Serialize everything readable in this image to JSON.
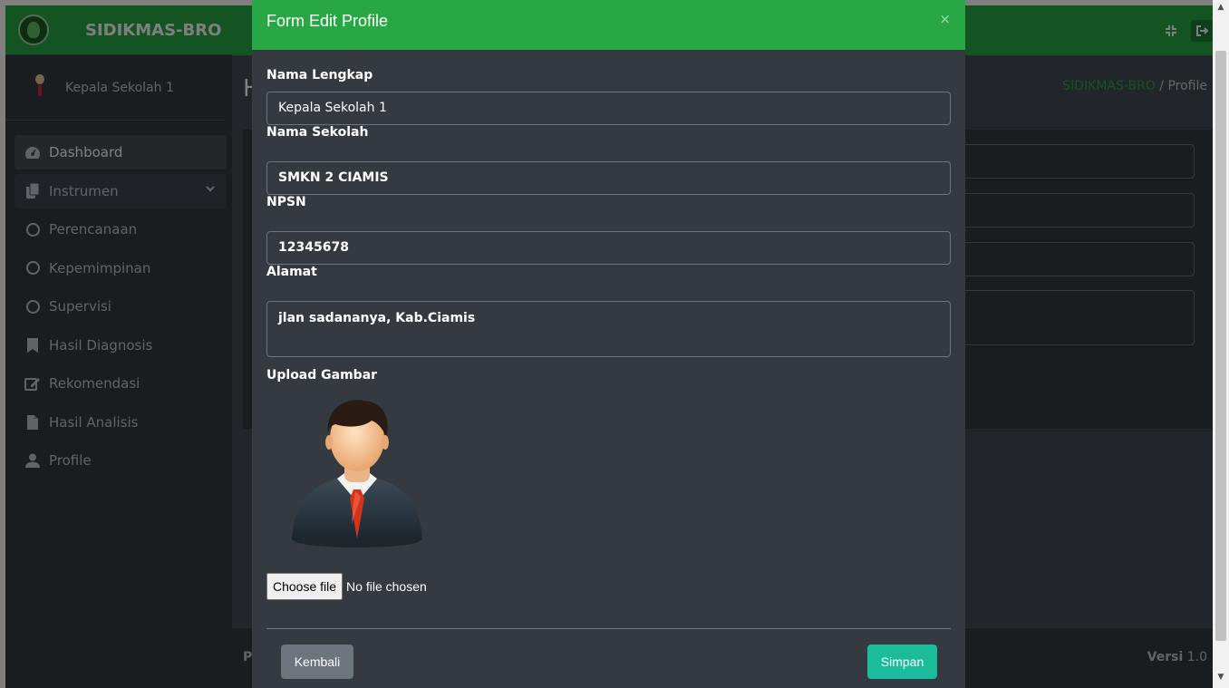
{
  "app": {
    "brand": "SIDIKMAS-BRO",
    "user_name": "Kepala Sekolah 1"
  },
  "sidebar": {
    "items": [
      {
        "label": "Dashboard",
        "icon": "tachometer-icon"
      },
      {
        "label": "Instrumen",
        "icon": "copy-icon"
      },
      {
        "label": "Perencanaan",
        "icon": "circle-icon"
      },
      {
        "label": "Kepemimpinan",
        "icon": "circle-icon"
      },
      {
        "label": "Supervisi",
        "icon": "circle-icon"
      },
      {
        "label": "Hasil Diagnosis",
        "icon": "bookmark-icon"
      },
      {
        "label": "Rekomendasi",
        "icon": "edit-icon"
      },
      {
        "label": "Hasil Analisis",
        "icon": "file-icon"
      },
      {
        "label": "Profile",
        "icon": "user-icon"
      }
    ]
  },
  "breadcrumb": {
    "home": "SIDIKMAS-BRO",
    "separator": "/",
    "current": "Profile"
  },
  "page_heading_initial": "H",
  "footer": {
    "left_initial": "P",
    "version_label": "Versi",
    "version_value": "1.0"
  },
  "modal": {
    "title": "Form Edit Profile",
    "close_symbol": "×",
    "fields": {
      "nama_lengkap": {
        "label": "Nama Lengkap",
        "value": "Kepala Sekolah 1"
      },
      "nama_sekolah": {
        "label": "Nama Sekolah",
        "value": "SMKN 2 CIAMIS"
      },
      "npsn": {
        "label": "NPSN",
        "value": "12345678"
      },
      "alamat": {
        "label": "Alamat",
        "value": "jlan sadananya, Kab.Ciamis"
      },
      "upload": {
        "label": "Upload Gambar",
        "button": "Choose file",
        "status": "No file chosen"
      }
    },
    "buttons": {
      "back": "Kembali",
      "save": "Simpan"
    }
  },
  "colors": {
    "accent": "#28a745",
    "sidebar_bg": "#343a40",
    "save_button": "#1abc9c",
    "back_button": "#6c757d"
  }
}
